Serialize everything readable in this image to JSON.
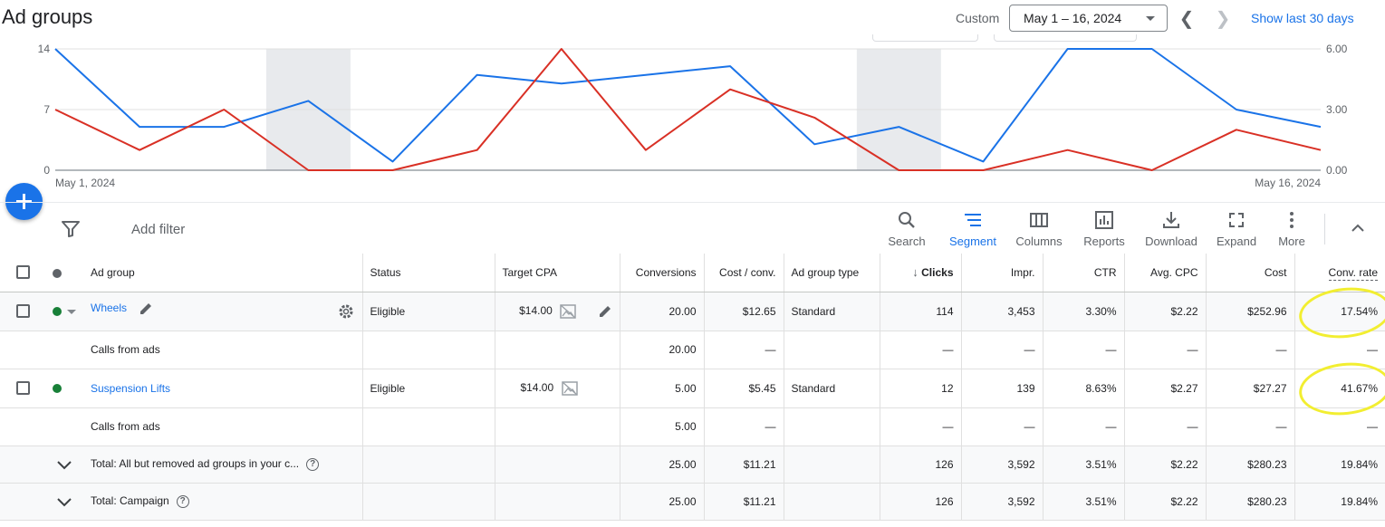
{
  "header": {
    "title": "Ad groups",
    "range_label": "Custom",
    "date_range": "May 1 – 16, 2024",
    "show_last": "Show last 30 days"
  },
  "chart_data": {
    "type": "line",
    "x": [
      "May 1, 2024",
      "May 2, 2024",
      "May 3, 2024",
      "May 4, 2024",
      "May 5, 2024",
      "May 6, 2024",
      "May 7, 2024",
      "May 8, 2024",
      "May 9, 2024",
      "May 10, 2024",
      "May 11, 2024",
      "May 12, 2024",
      "May 13, 2024",
      "May 14, 2024",
      "May 15, 2024",
      "May 16, 2024"
    ],
    "xtick_labels": [
      "May 1, 2024",
      "May 16, 2024"
    ],
    "left_axis": {
      "ticks": [
        "0",
        "7",
        "14"
      ],
      "ylim": [
        0,
        14
      ]
    },
    "right_axis": {
      "ticks": [
        "0.00",
        "3.00",
        "6.00"
      ],
      "ylim": [
        0,
        6
      ]
    },
    "shaded_ranges": [
      [
        3,
        4
      ],
      [
        10,
        11
      ]
    ],
    "series": [
      {
        "color": "#1a73e8",
        "axis": "left",
        "values": [
          14,
          5,
          5,
          8,
          1,
          11,
          10,
          11,
          12,
          3,
          5,
          1,
          14,
          14,
          7,
          5
        ]
      },
      {
        "color": "#d93025",
        "axis": "right",
        "values": [
          3,
          1,
          3,
          0,
          0,
          1,
          6,
          1,
          4,
          2.6,
          0,
          0,
          1,
          0,
          2,
          1
        ]
      }
    ],
    "grid": true
  },
  "toolbar": {
    "add_filter": "Add filter",
    "search": "Search",
    "segment": "Segment",
    "columns": "Columns",
    "reports": "Reports",
    "download": "Download",
    "expand": "Expand",
    "more": "More"
  },
  "table": {
    "headers": {
      "ad_group": "Ad group",
      "status": "Status",
      "target_cpa": "Target CPA",
      "conversions": "Conversions",
      "cost_conv": "Cost / conv.",
      "type": "Ad group type",
      "clicks": "Clicks",
      "impr": "Impr.",
      "ctr": "CTR",
      "avg_cpc": "Avg. CPC",
      "cost": "Cost",
      "conv_rate": "Conv. rate"
    },
    "rows": [
      {
        "name": "Wheels",
        "status": "Eligible",
        "target_cpa": "$14.00",
        "conversions": "20.00",
        "cost_conv": "$12.65",
        "type": "Standard",
        "clicks": "114",
        "impr": "3,453",
        "ctr": "3.30%",
        "avg_cpc": "$2.22",
        "cost": "$252.96",
        "conv_rate": "17.54%"
      },
      {
        "name": "Calls from ads",
        "status": "",
        "target_cpa": "",
        "conversions": "20.00",
        "cost_conv": "—",
        "type": "",
        "clicks": "—",
        "impr": "—",
        "ctr": "—",
        "avg_cpc": "—",
        "cost": "—",
        "conv_rate": "—"
      },
      {
        "name": "Suspension Lifts",
        "status": "Eligible",
        "target_cpa": "$14.00",
        "conversions": "5.00",
        "cost_conv": "$5.45",
        "type": "Standard",
        "clicks": "12",
        "impr": "139",
        "ctr": "8.63%",
        "avg_cpc": "$2.27",
        "cost": "$27.27",
        "conv_rate": "41.67%"
      },
      {
        "name": "Calls from ads",
        "status": "",
        "target_cpa": "",
        "conversions": "5.00",
        "cost_conv": "—",
        "type": "",
        "clicks": "—",
        "impr": "—",
        "ctr": "—",
        "avg_cpc": "—",
        "cost": "—",
        "conv_rate": "—"
      },
      {
        "name": "Total: All but removed ad groups in your c...",
        "status": "",
        "target_cpa": "",
        "conversions": "25.00",
        "cost_conv": "$11.21",
        "type": "",
        "clicks": "126",
        "impr": "3,592",
        "ctr": "3.51%",
        "avg_cpc": "$2.22",
        "cost": "$280.23",
        "conv_rate": "19.84%"
      },
      {
        "name": "Total: Campaign",
        "status": "",
        "target_cpa": "",
        "conversions": "25.00",
        "cost_conv": "$11.21",
        "type": "",
        "clicks": "126",
        "impr": "3,592",
        "ctr": "3.51%",
        "avg_cpc": "$2.22",
        "cost": "$280.23",
        "conv_rate": "19.84%"
      }
    ]
  },
  "colors": {
    "accent": "#1a73e8",
    "eligible": "#188038",
    "highlight": "#f2ee31"
  }
}
